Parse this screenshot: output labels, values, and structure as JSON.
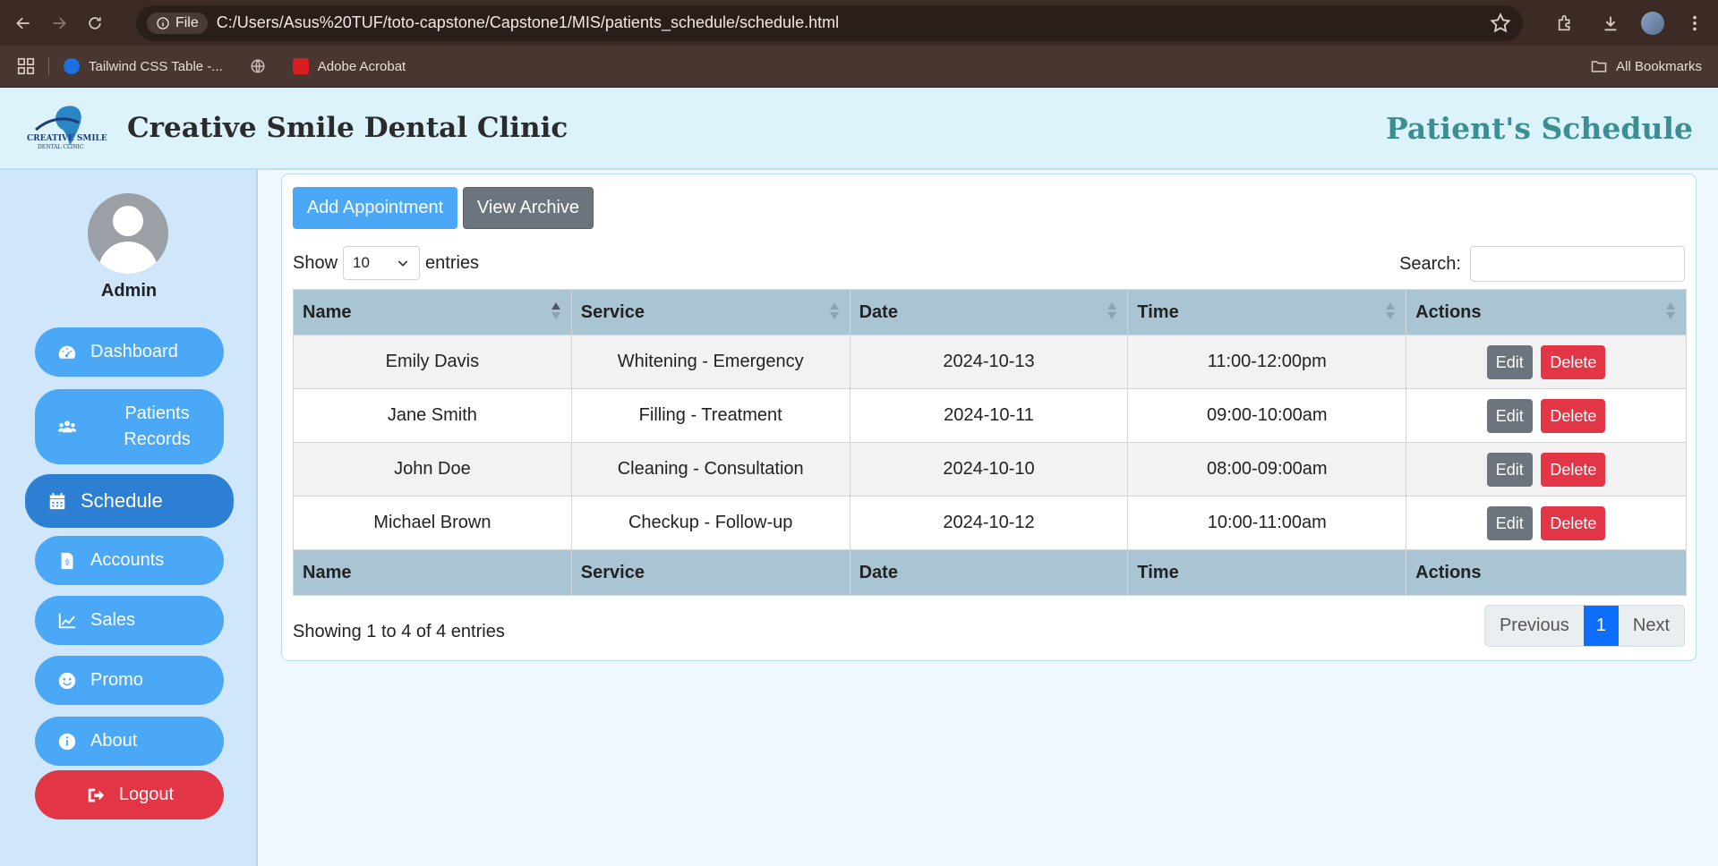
{
  "browser": {
    "file_chip": "File",
    "url": "C:/Users/Asus%20TUF/toto-capstone/Capstone1/MIS/patients_schedule/schedule.html",
    "bookmarks": [
      {
        "label": "Tailwind CSS Table -...",
        "color": "#1e6fe0"
      },
      {
        "label": "",
        "color": "#9aa0a6"
      },
      {
        "label": "Adobe Acrobat",
        "color": "#d81e1e"
      }
    ],
    "all_bookmarks": "All Bookmarks"
  },
  "header": {
    "title": "Creative Smile Dental Clinic",
    "page_heading": "Patient's Schedule"
  },
  "sidebar": {
    "user": "Admin",
    "items": [
      {
        "label": "Dashboard",
        "icon": "gauge-icon"
      },
      {
        "label": "Patients Records",
        "icon": "users-icon"
      },
      {
        "label": "Schedule",
        "icon": "calendar-icon",
        "active": true
      },
      {
        "label": "Accounts",
        "icon": "invoice-icon"
      },
      {
        "label": "Sales",
        "icon": "chart-icon"
      },
      {
        "label": "Promo",
        "icon": "smile-icon"
      },
      {
        "label": "About",
        "icon": "info-icon"
      }
    ],
    "logout": "Logout"
  },
  "toolbar": {
    "add_label": "Add Appointment",
    "archive_label": "View Archive"
  },
  "table_controls": {
    "show_label": "Show",
    "page_length": "10",
    "entries_label": "entries",
    "search_label": "Search:"
  },
  "table": {
    "columns": [
      "Name",
      "Service",
      "Date",
      "Time",
      "Actions"
    ],
    "rows": [
      {
        "name": "Emily Davis",
        "service": "Whitening - Emergency",
        "date": "2024-10-13",
        "time": "11:00-12:00pm"
      },
      {
        "name": "Jane Smith",
        "service": "Filling - Treatment",
        "date": "2024-10-11",
        "time": "09:00-10:00am"
      },
      {
        "name": "John Doe",
        "service": "Cleaning - Consultation",
        "date": "2024-10-10",
        "time": "08:00-09:00am"
      },
      {
        "name": "Michael Brown",
        "service": "Checkup - Follow-up",
        "date": "2024-10-12",
        "time": "10:00-11:00am"
      }
    ],
    "edit_label": "Edit",
    "delete_label": "Delete"
  },
  "footer": {
    "info": "Showing 1 to 4 of 4 entries",
    "previous": "Previous",
    "current_page": "1",
    "next": "Next"
  },
  "colors": {
    "primary": "#4aa8f6",
    "active_nav": "#2c7fd2",
    "danger": "#e23646",
    "secondary": "#6c757d",
    "heading_teal": "#3b8f93"
  }
}
